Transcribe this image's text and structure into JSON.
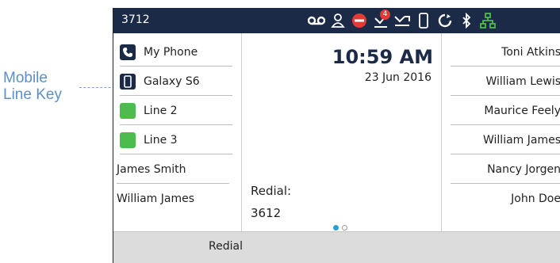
{
  "annotation": {
    "line1": "Mobile",
    "line2": "Line Key"
  },
  "status_bar": {
    "extension": "3712",
    "missed_calls_badge": "4",
    "icons": [
      "voicemail-icon",
      "contacts-icon",
      "do-not-disturb-icon",
      "missed-calls-icon",
      "call-forward-icon",
      "mobile-phone-icon",
      "sync-icon",
      "bluetooth-icon",
      "network-icon"
    ]
  },
  "line_keys": [
    {
      "label": "My Phone",
      "icon": "phone-icon",
      "color": "#1b2a47"
    },
    {
      "label": "Galaxy S6",
      "icon": "mobile-phone-icon",
      "color": "#1b2a47"
    },
    {
      "label": "Line 2",
      "icon": "line-status-icon",
      "color": "#4dbb4d"
    },
    {
      "label": "Line 3",
      "icon": "line-status-icon",
      "color": "#4dbb4d"
    },
    {
      "label": "James Smith"
    },
    {
      "label": "William James"
    }
  ],
  "center": {
    "time": "10:59 AM",
    "date": "23 Jun 2016",
    "redial_label": "Redial:",
    "redial_number": "3612"
  },
  "speed_dials": [
    {
      "label": "Toni Atkins"
    },
    {
      "label": "William Lewis"
    },
    {
      "label": "Maurice Feely"
    },
    {
      "label": "William James"
    },
    {
      "label": "Nancy Jorgen"
    },
    {
      "label": "John Doe"
    }
  ],
  "softkeys": {
    "redial": "Redial"
  },
  "colors": {
    "status_bar": "#1b2a47",
    "accent_blue": "#2a9fd6",
    "line_green": "#4dbb4d",
    "softkey_bar": "#dcdcdc",
    "callout": "#5b8fc7"
  }
}
